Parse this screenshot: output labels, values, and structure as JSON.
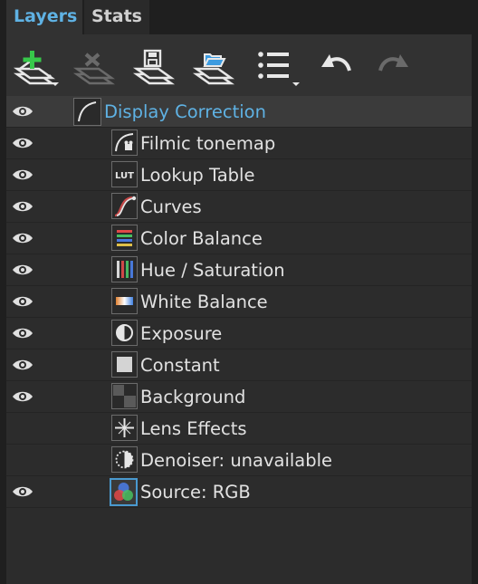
{
  "tabs": [
    {
      "label": "Layers",
      "active": true
    },
    {
      "label": "Stats",
      "active": false
    }
  ],
  "toolbar": [
    {
      "name": "add-layer-icon",
      "enabled": true,
      "dropdown": true
    },
    {
      "name": "remove-layer-icon",
      "enabled": false,
      "dropdown": false
    },
    {
      "name": "save-layers-icon",
      "enabled": true,
      "dropdown": false
    },
    {
      "name": "open-layers-icon",
      "enabled": true,
      "dropdown": false
    },
    {
      "name": "list-options-icon",
      "enabled": true,
      "dropdown": true
    },
    {
      "name": "undo-icon",
      "enabled": true,
      "dropdown": false
    },
    {
      "name": "redo-icon",
      "enabled": false,
      "dropdown": false
    }
  ],
  "layers": [
    {
      "label": "Display Correction",
      "icon": "display-correction-icon",
      "visible": true,
      "selected": true,
      "level": 0
    },
    {
      "label": "Filmic tonemap",
      "icon": "filmic-tonemap-icon",
      "visible": true,
      "selected": false,
      "level": 1
    },
    {
      "label": "Lookup Table",
      "icon": "lut-icon",
      "icon_text": "LUT",
      "visible": true,
      "selected": false,
      "level": 1
    },
    {
      "label": "Curves",
      "icon": "curves-icon",
      "visible": true,
      "selected": false,
      "level": 1
    },
    {
      "label": "Color Balance",
      "icon": "color-balance-icon",
      "visible": true,
      "selected": false,
      "level": 1
    },
    {
      "label": "Hue / Saturation",
      "icon": "hue-saturation-icon",
      "visible": true,
      "selected": false,
      "level": 1
    },
    {
      "label": "White Balance",
      "icon": "white-balance-icon",
      "visible": true,
      "selected": false,
      "level": 1
    },
    {
      "label": "Exposure",
      "icon": "exposure-icon",
      "visible": true,
      "selected": false,
      "level": 1
    },
    {
      "label": "Constant",
      "icon": "constant-icon",
      "visible": true,
      "selected": false,
      "level": 1
    },
    {
      "label": "Background",
      "icon": "background-icon",
      "visible": true,
      "selected": false,
      "level": 1
    },
    {
      "label": "Lens Effects",
      "icon": "lens-effects-icon",
      "visible": false,
      "selected": false,
      "level": 1
    },
    {
      "label": "Denoiser: unavailable",
      "icon": "denoiser-icon",
      "visible": false,
      "selected": false,
      "level": 1
    },
    {
      "label": "Source: RGB",
      "icon": "source-rgb-icon",
      "visible": true,
      "selected": false,
      "level": 1
    }
  ],
  "colors": {
    "accent": "#5fb2e4",
    "add_green": "#37c84a",
    "folder_blue": "#3c9be0"
  }
}
